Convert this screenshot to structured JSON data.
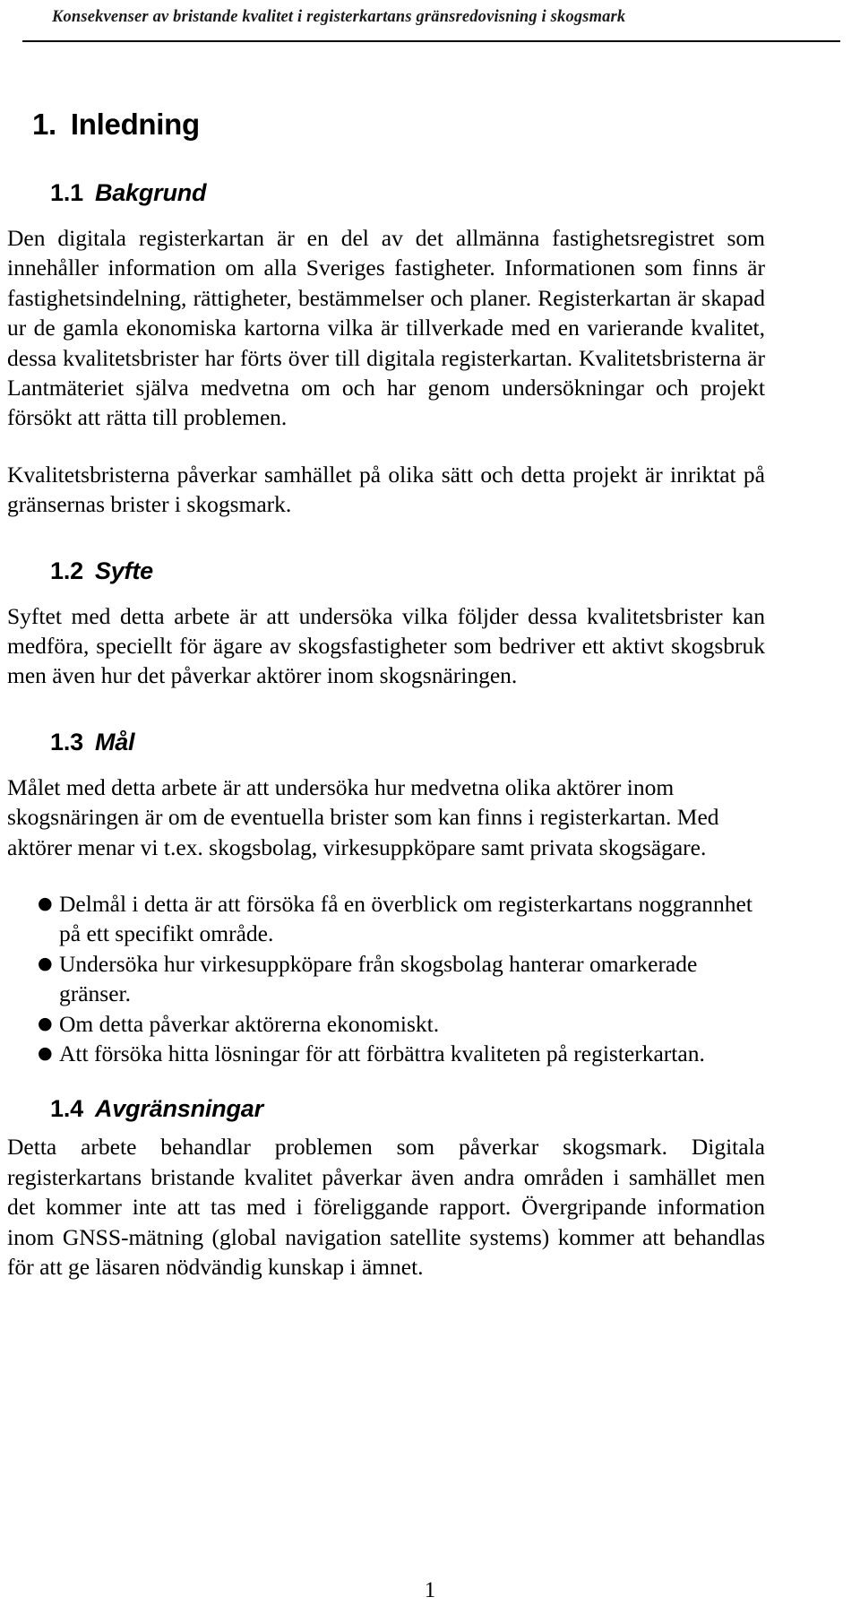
{
  "document": {
    "running_header": "Konsekvenser av bristande kvalitet i registerkartans gränsredovisning i skogsmark",
    "page_number": "1"
  },
  "sections": {
    "chapter": {
      "number": "1.",
      "title": "Inledning"
    },
    "bakgrund": {
      "number": "1.1",
      "title": "Bakgrund",
      "paragraph_1": "Den digitala registerkartan är en del av det allmänna fastighetsregistret som innehåller information om alla Sveriges fastigheter. Informationen som finns är fastighetsindelning, rättigheter, bestämmelser och planer. Registerkartan är skapad ur de gamla ekonomiska kartorna vilka är tillverkade med en varierande kvalitet, dessa kvalitetsbrister har förts över till digitala registerkartan. Kvalitetsbristerna är Lantmäteriet själva medvetna om och har genom undersökningar och projekt försökt att rätta till problemen.",
      "paragraph_2": "Kvalitetsbristerna påverkar samhället på olika sätt och detta projekt är inriktat på gränsernas brister i skogsmark."
    },
    "syfte": {
      "number": "1.2",
      "title": "Syfte",
      "paragraph_1": "Syftet med detta arbete är att undersöka vilka följder dessa kvalitetsbrister kan medföra, speciellt för ägare av skogsfastigheter som bedriver ett aktivt skogsbruk men även hur det påverkar aktörer inom skogsnäringen."
    },
    "mal": {
      "number": "1.3",
      "title": "Mål",
      "paragraph_1": "Målet med detta arbete är att undersöka hur medvetna olika aktörer inom skogsnäringen är om de eventuella brister som kan finns i registerkartan. Med aktörer menar vi t.ex. skogsbolag, virkesuppköpare samt privata skogsägare.",
      "bullet_marker": "●",
      "bullets": [
        "Delmål i detta är att försöka få en överblick om registerkartans noggrannhet på ett specifikt område.",
        "Undersöka hur virkesuppköpare från skogsbolag hanterar omarkerade gränser.",
        "Om detta påverkar aktörerna ekonomiskt.",
        "Att försöka hitta lösningar för att förbättra kvaliteten på registerkartan."
      ]
    },
    "avgransningar": {
      "number": "1.4",
      "title": "Avgränsningar",
      "paragraph_1": "Detta arbete behandlar problemen som påverkar skogsmark. Digitala registerkartans bristande kvalitet påverkar även andra områden i samhället men det kommer inte att tas med i föreliggande rapport. Övergripande information inom GNSS-mätning (global navigation satellite systems) kommer att behandlas för att ge läsaren nödvändig kunskap i ämnet."
    }
  }
}
